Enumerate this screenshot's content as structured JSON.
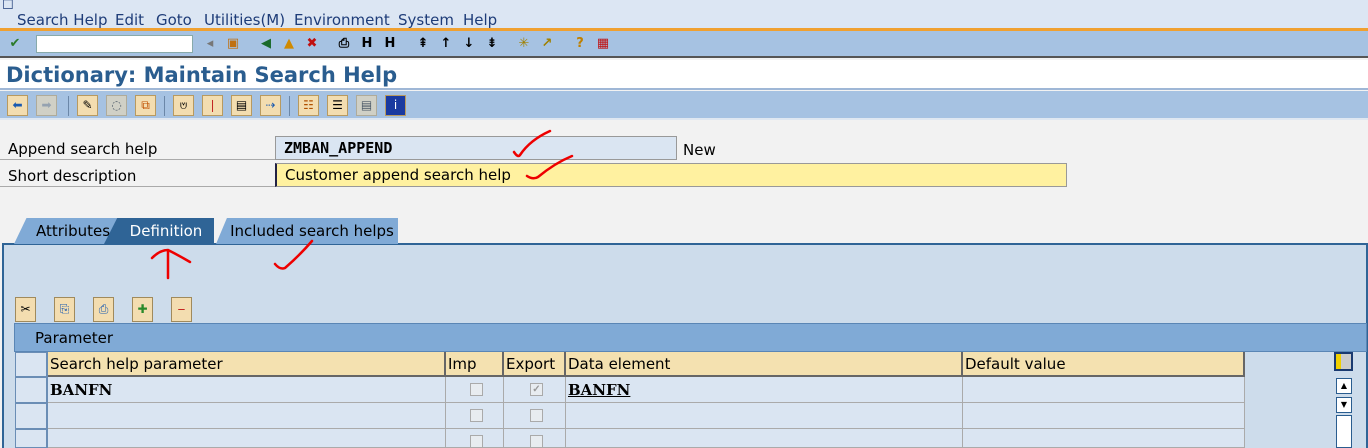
{
  "menu": [
    "Search Help",
    "Edit",
    "Goto",
    "Utilities(M)",
    "Environment",
    "System",
    "Help"
  ],
  "title": "Dictionary: Maintain Search Help",
  "fields": {
    "append_label": "Append search help",
    "append_value": "ZMBAN_APPEND",
    "append_status": "New",
    "short_label": "Short description",
    "short_value": "Customer append search help"
  },
  "tabs": {
    "attributes": "Attributes",
    "definition": "Definition",
    "included": "Included search helps",
    "active": "Definition"
  },
  "grid": {
    "title": "Parameter",
    "columns": [
      "Search help parameter",
      "Imp",
      "Export",
      "Data element",
      "Default value"
    ],
    "rows": [
      {
        "param": "BANFN",
        "imp": false,
        "export": true,
        "data_element": "BANFN",
        "default": ""
      },
      {
        "param": "",
        "imp": false,
        "export": false,
        "data_element": "",
        "default": ""
      },
      {
        "param": "",
        "imp": false,
        "export": false,
        "data_element": "",
        "default": ""
      }
    ]
  },
  "colors": {
    "accent": "#2a5d8f",
    "toolbar": "#a6c2e2",
    "active_tab": "#2f6496",
    "input_yellow": "#fff1a0"
  }
}
